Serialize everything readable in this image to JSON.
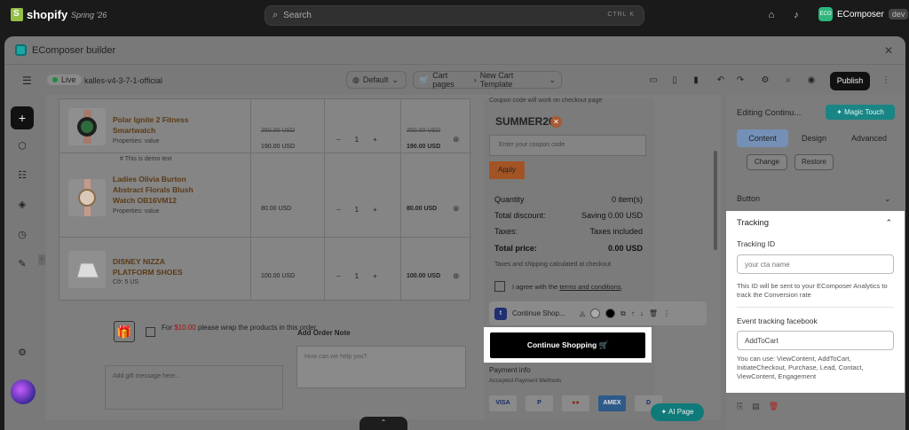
{
  "topbar": {
    "brand": "shopify",
    "edition": "Spring '26",
    "search_placeholder": "Search",
    "shortcut": "CTRL K",
    "store_badge": "ECO",
    "store_name": "EComposer",
    "store_tag": "dev"
  },
  "window": {
    "title": "EComposer builder"
  },
  "toolbar": {
    "live_label": "Live",
    "theme_name": "kalles-v4-3-7-1-official",
    "default_label": "Default",
    "page_type": "Cart pages",
    "template": "New Cart Template",
    "publish": "Publish"
  },
  "cart": {
    "rows": [
      {
        "name": "Polar Ignite 2 Fitness Smartwatch",
        "props": "Properties: value",
        "note": "# This is demo text",
        "old_price": "250.00 USD",
        "price": "190.00 USD",
        "qty": "1",
        "total_old": "250.00 USD",
        "total": "190.00 USD"
      },
      {
        "name": "Ladies Olivia Burton Abstract Florals Blush Watch OB16VM12",
        "props": "Properties: value",
        "note": "",
        "old_price": "",
        "price": "80.00 USD",
        "qty": "1",
        "total_old": "",
        "total": "80.00 USD"
      },
      {
        "name": "DISNEY NIZZA PLATFORM SHOES",
        "props": "Cỡ: 5 US",
        "note": "",
        "old_price": "",
        "price": "100.00 USD",
        "qty": "1",
        "total_old": "",
        "total": "100.00 USD"
      }
    ],
    "qty_minus": "−",
    "qty_plus": "+"
  },
  "gift": {
    "text_before": "For",
    "amount": "$10.00",
    "text_after": "please wrap the products in this order.",
    "message_placeholder": "Add gift message here..."
  },
  "order_note": {
    "label": "Add Order Note",
    "placeholder": "How can we help you?"
  },
  "summary": {
    "coupon_note": "Coupon code will work on checkout page",
    "coupon_code": "SUMMER20",
    "coupon_placeholder": "Enter your coupon code",
    "apply": "Apply",
    "rows": [
      {
        "label": "Quantity",
        "value": "0 item(s)"
      },
      {
        "label": "Total discount:",
        "value": "Saving 0.00 USD"
      },
      {
        "label": "Taxes:",
        "value": "Taxes included"
      },
      {
        "label": "Total price:",
        "value": "0.00 USD"
      }
    ],
    "shipping_note": "Taxes and shipping calculated at checkout",
    "agree_prefix": "I agree with the",
    "agree_link": "terms and conditions",
    "agree_suffix": "."
  },
  "float_toolbar": {
    "label": "Continue Shop...",
    "badge": "t"
  },
  "cta": {
    "label": "Continue Shopping"
  },
  "payment": {
    "title": "Payment info",
    "subtitle": "Accepted Payment Methods",
    "cards": [
      "VISA",
      "P",
      "●●",
      "AMEX",
      "D"
    ]
  },
  "ai_page": "AI Page",
  "panel": {
    "editing": "Editing Continu...",
    "magic": "Magic Touch",
    "tabs": [
      "Content",
      "Design",
      "Advanced"
    ],
    "change": "Change",
    "restore": "Restore",
    "button_section": "Button",
    "tracking": {
      "title": "Tracking",
      "id_label": "Tracking ID",
      "id_placeholder": "your cta name",
      "id_help": "This ID will be sent to your EComposer Analytics to track the Conversion rate",
      "fb_label": "Event tracking facebook",
      "fb_value": "AddToCart",
      "fb_help": "You can use: ViewContent, AddToCart, InitiateCheckout, Purchase, Lead, Contact, ViewContent, Engagement"
    }
  },
  "colors": {
    "accent": "#1a8585",
    "cta": "#000000",
    "publish": "#111111"
  }
}
